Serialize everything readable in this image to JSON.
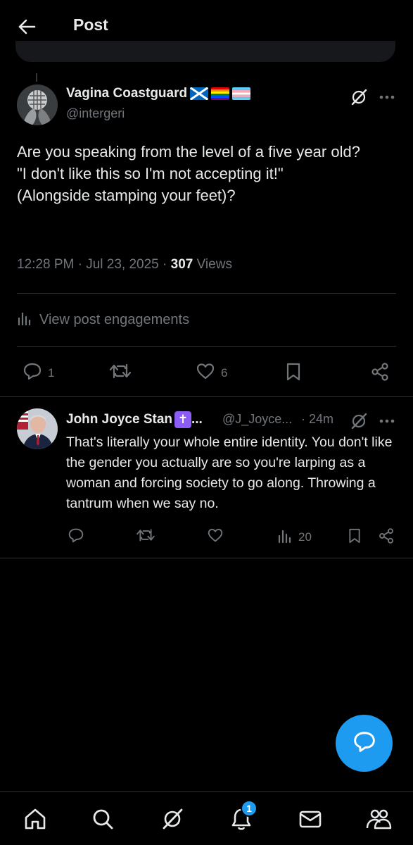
{
  "header": {
    "title": "Post"
  },
  "post": {
    "author_name": "Vagina Coastguard",
    "author_handle": "@intergeri",
    "flags": [
      "scotland-flag",
      "rainbow-pride-flag",
      "transgender-pride-flag"
    ],
    "text": "Are you speaking from the level of a five year old?\n\"I don't like this so I'm not accepting it!\"\n(Alongside stamping your feet)?",
    "timestamp": "12:28 PM · Jul 23, 2025 · ",
    "views_count": "307",
    "views_label": " Views",
    "engagements_label": "View post engagements",
    "reply_count": "1",
    "like_count": "6"
  },
  "reply": {
    "author_name": "John Joyce Stan",
    "name_suffix": " ...",
    "cross_glyph": "✝",
    "author_handle": "@J_Joyce...",
    "time": "· 24m",
    "text": "That's literally your whole entire identity. You don't like the gender you actually are so you're larping as a woman and forcing society to go along. Throwing a tantrum when we say no.",
    "views_count": "20"
  },
  "notifications_badge": "1",
  "colors": {
    "accent": "#1d9bf0",
    "muted": "#71767b",
    "divider": "#2f3336",
    "text": "#e7e9ea"
  },
  "icons": [
    "back-arrow-icon",
    "grok-icon",
    "more-icon",
    "bar-chart-icon",
    "reply-icon",
    "retweet-icon",
    "heart-icon",
    "bookmark-icon",
    "share-icon",
    "compose-reply-icon",
    "home-icon",
    "search-icon",
    "bell-icon",
    "mail-icon",
    "communities-icon"
  ]
}
